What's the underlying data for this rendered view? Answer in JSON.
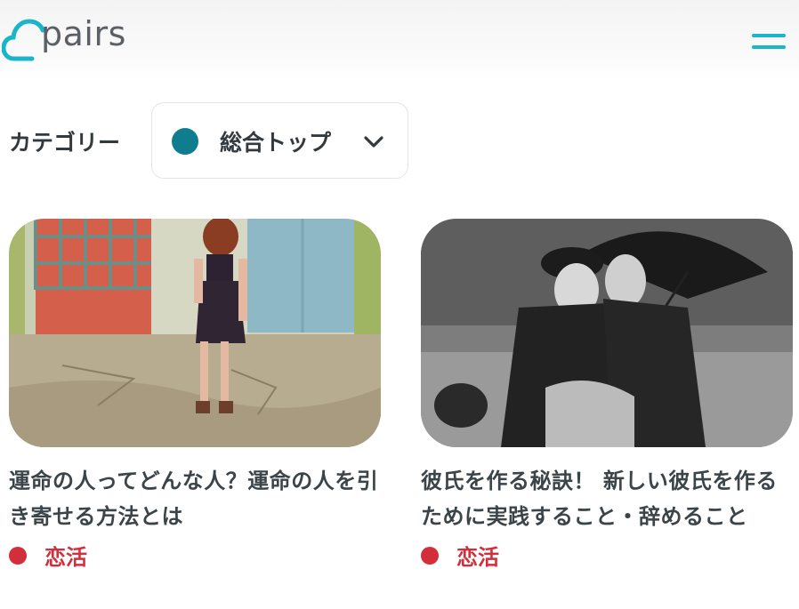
{
  "header": {
    "logo_text": "pairs",
    "menu_icon": "hamburger-menu-icon"
  },
  "category_filter": {
    "label": "カテゴリー",
    "selected": "総合トップ",
    "dot_color": "#107d8f",
    "chevron_icon": "chevron-down-icon"
  },
  "articles": [
    {
      "title": "運命の人ってどんな人？運命の人を引き寄せる方法とは",
      "category": "恋活",
      "category_color": "#d32f3a",
      "image": "photo-woman-walking-street"
    },
    {
      "title": "彼氏を作る秘訣！ 新しい彼氏を作るために実践すること・辞めること",
      "category": "恋活",
      "category_color": "#d32f3a",
      "image": "photo-couple-kissing-umbrella"
    }
  ],
  "colors": {
    "brand": "#1bb5c9",
    "text": "#3b4448",
    "accent_red": "#d32f3a"
  }
}
